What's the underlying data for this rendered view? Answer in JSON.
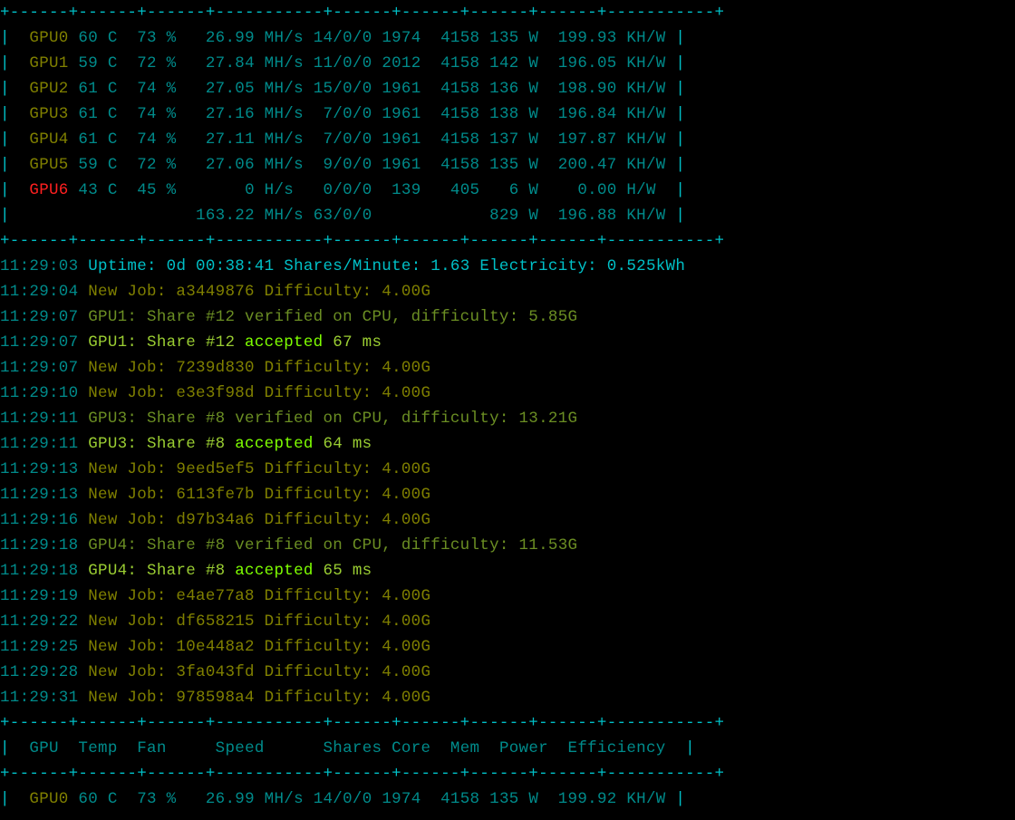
{
  "border_top": "+------+------+------+-----------+------+------+------+------+-----------+",
  "header": {
    "cols": [
      "GPU",
      "Temp",
      "Fan",
      "Speed",
      "Shares",
      "Core",
      "Mem",
      "Power",
      "Efficiency"
    ]
  },
  "gpu_rows_top": [
    {
      "gpu": "GPU0",
      "temp": "60 C",
      "fan": "73 %",
      "speed": "26.99 MH/s",
      "shares": "14/0/0",
      "core": "1974",
      "mem": "4158",
      "power": "135 W",
      "eff": "199.93 KH/W",
      "fail": false
    },
    {
      "gpu": "GPU1",
      "temp": "59 C",
      "fan": "72 %",
      "speed": "27.84 MH/s",
      "shares": "11/0/0",
      "core": "2012",
      "mem": "4158",
      "power": "142 W",
      "eff": "196.05 KH/W",
      "fail": false
    },
    {
      "gpu": "GPU2",
      "temp": "61 C",
      "fan": "74 %",
      "speed": "27.05 MH/s",
      "shares": "15/0/0",
      "core": "1961",
      "mem": "4158",
      "power": "136 W",
      "eff": "198.90 KH/W",
      "fail": false
    },
    {
      "gpu": "GPU3",
      "temp": "61 C",
      "fan": "74 %",
      "speed": "27.16 MH/s",
      "shares": " 7/0/0",
      "core": "1961",
      "mem": "4158",
      "power": "138 W",
      "eff": "196.84 KH/W",
      "fail": false
    },
    {
      "gpu": "GPU4",
      "temp": "61 C",
      "fan": "74 %",
      "speed": "27.11 MH/s",
      "shares": " 7/0/0",
      "core": "1961",
      "mem": "4158",
      "power": "137 W",
      "eff": "197.87 KH/W",
      "fail": false
    },
    {
      "gpu": "GPU5",
      "temp": "59 C",
      "fan": "72 %",
      "speed": "27.06 MH/s",
      "shares": " 9/0/0",
      "core": "1961",
      "mem": "4158",
      "power": "135 W",
      "eff": "200.47 KH/W",
      "fail": false
    },
    {
      "gpu": "GPU6",
      "temp": "43 C",
      "fan": "45 %",
      "speed": "    0 H/s ",
      "shares": " 0/0/0",
      "core": " 139",
      "mem": " 405",
      "power": "  6 W",
      "eff": "  0.00 H/W ",
      "fail": true
    }
  ],
  "totals": {
    "speed": "163.22 MH/s",
    "shares": "63/0/0",
    "power": "829 W",
    "eff": "196.88 KH/W"
  },
  "status_line": {
    "time": "11:29:03",
    "uptime_label": "Uptime: ",
    "uptime": "0d 00:38:41",
    "spm_label": " Shares/Minute: ",
    "spm": "1.63",
    "elec_label": " Electricity: ",
    "elec": "0.525kWh"
  },
  "log": [
    {
      "time": "11:29:04",
      "type": "job",
      "job": "a3449876",
      "diff": "4.00G"
    },
    {
      "time": "11:29:07",
      "type": "verify",
      "gpu": "GPU1",
      "share": "12",
      "diff": "5.85G"
    },
    {
      "time": "11:29:07",
      "type": "accept",
      "gpu": "GPU1",
      "share": "12",
      "ms": "67"
    },
    {
      "time": "11:29:07",
      "type": "job",
      "job": "7239d830",
      "diff": "4.00G"
    },
    {
      "time": "11:29:10",
      "type": "job",
      "job": "e3e3f98d",
      "diff": "4.00G"
    },
    {
      "time": "11:29:11",
      "type": "verify",
      "gpu": "GPU3",
      "share": "8",
      "diff": "13.21G"
    },
    {
      "time": "11:29:11",
      "type": "accept",
      "gpu": "GPU3",
      "share": "8",
      "ms": "64"
    },
    {
      "time": "11:29:13",
      "type": "job",
      "job": "9eed5ef5",
      "diff": "4.00G"
    },
    {
      "time": "11:29:13",
      "type": "job",
      "job": "6113fe7b",
      "diff": "4.00G"
    },
    {
      "time": "11:29:16",
      "type": "job",
      "job": "d97b34a6",
      "diff": "4.00G"
    },
    {
      "time": "11:29:18",
      "type": "verify",
      "gpu": "GPU4",
      "share": "8",
      "diff": "11.53G"
    },
    {
      "time": "11:29:18",
      "type": "accept",
      "gpu": "GPU4",
      "share": "8",
      "ms": "65"
    },
    {
      "time": "11:29:19",
      "type": "job",
      "job": "e4ae77a8",
      "diff": "4.00G"
    },
    {
      "time": "11:29:22",
      "type": "job",
      "job": "df658215",
      "diff": "4.00G"
    },
    {
      "time": "11:29:25",
      "type": "job",
      "job": "10e448a2",
      "diff": "4.00G"
    },
    {
      "time": "11:29:28",
      "type": "job",
      "job": "3fa043fd",
      "diff": "4.00G"
    },
    {
      "time": "11:29:31",
      "type": "job",
      "job": "978598a4",
      "diff": "4.00G"
    }
  ],
  "gpu_rows_bottom": [
    {
      "gpu": "GPU0",
      "temp": "60 C",
      "fan": "73 %",
      "speed": "26.99 MH/s",
      "shares": "14/0/0",
      "core": "1974",
      "mem": "4158",
      "power": "135 W",
      "eff": "199.92 KH/W",
      "fail": false
    }
  ]
}
